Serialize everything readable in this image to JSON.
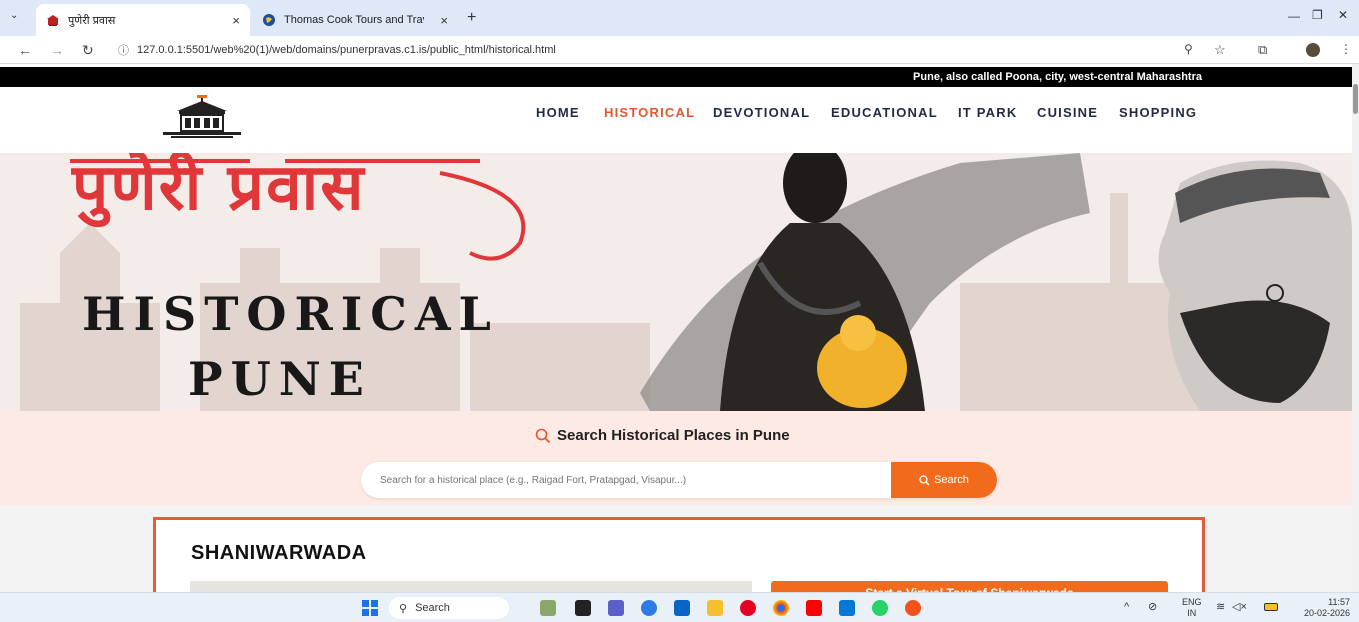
{
  "browser": {
    "tabs": [
      {
        "title": "पुणेरी प्रवास",
        "close": "×",
        "active": true
      },
      {
        "title": "Thomas Cook Tours and Travels",
        "close": "×",
        "active": false
      }
    ],
    "new_tab": "+",
    "url": "127.0.0.1:5501/web%20(1)/web/domains/punerpravas.c1.is/public_html/historical.html",
    "window_controls": [
      "—",
      "❐",
      "✕"
    ]
  },
  "site": {
    "ticker_text": "Pune, also called Poona, city, west-central Maharashtra",
    "nav": [
      "HOME",
      "HISTORICAL",
      "DEVOTIONAL",
      "EDUCATIONAL",
      "IT PARK",
      "CUISINE",
      "SHOPPING"
    ],
    "active_nav": "HISTORICAL",
    "hero": {
      "devanagari_title": "पुणेरी प्रवास",
      "line1": "HISTORICAL",
      "line2": "PUNE"
    },
    "search": {
      "heading": "Search Historical Places in Pune",
      "placeholder": "Search for a historical place (e.g., Raigad Fort, Pratapgad, Visapur...)",
      "button": "Search"
    },
    "place": {
      "title": "SHANIWARWADA",
      "virtual_tour": "Start a Virtual Tour of Shaniwarwada"
    }
  },
  "taskbar": {
    "search_label": "Search",
    "lang": "ENG",
    "region": "IN",
    "time": "11:57",
    "date": "20-02-2026"
  },
  "colors": {
    "accent": "#e4572e",
    "search_button": "#f26b1d",
    "nav_text": "#1f2a44",
    "tab_strip": "#dee8f6"
  }
}
